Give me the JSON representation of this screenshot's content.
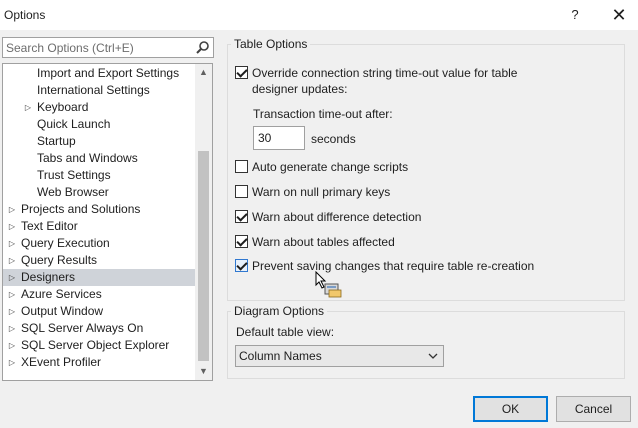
{
  "window": {
    "title": "Options",
    "help_label": "?",
    "close_label": "✕"
  },
  "search": {
    "placeholder": "Search Options (Ctrl+E)"
  },
  "tree": {
    "items": [
      {
        "label": "Import and Export Settings",
        "level": 1,
        "expandable": false,
        "selected": false
      },
      {
        "label": "International Settings",
        "level": 1,
        "expandable": false,
        "selected": false
      },
      {
        "label": "Keyboard",
        "level": 1,
        "expandable": true,
        "selected": false
      },
      {
        "label": "Quick Launch",
        "level": 1,
        "expandable": false,
        "selected": false
      },
      {
        "label": "Startup",
        "level": 1,
        "expandable": false,
        "selected": false
      },
      {
        "label": "Tabs and Windows",
        "level": 1,
        "expandable": false,
        "selected": false
      },
      {
        "label": "Trust Settings",
        "level": 1,
        "expandable": false,
        "selected": false
      },
      {
        "label": "Web Browser",
        "level": 1,
        "expandable": false,
        "selected": false
      },
      {
        "label": "Projects and Solutions",
        "level": 0,
        "expandable": true,
        "selected": false
      },
      {
        "label": "Text Editor",
        "level": 0,
        "expandable": true,
        "selected": false
      },
      {
        "label": "Query Execution",
        "level": 0,
        "expandable": true,
        "selected": false
      },
      {
        "label": "Query Results",
        "level": 0,
        "expandable": true,
        "selected": false
      },
      {
        "label": "Designers",
        "level": 0,
        "expandable": true,
        "selected": true
      },
      {
        "label": "Azure Services",
        "level": 0,
        "expandable": true,
        "selected": false
      },
      {
        "label": "Output Window",
        "level": 0,
        "expandable": true,
        "selected": false
      },
      {
        "label": "SQL Server Always On",
        "level": 0,
        "expandable": true,
        "selected": false
      },
      {
        "label": "SQL Server Object Explorer",
        "level": 0,
        "expandable": true,
        "selected": false
      },
      {
        "label": "XEvent Profiler",
        "level": 0,
        "expandable": true,
        "selected": false
      }
    ]
  },
  "table_options": {
    "title": "Table Options",
    "override_label_line1": "Override connection string time-out value for table",
    "override_label_line2": "designer updates:",
    "override_checked": true,
    "timeout_label": "Transaction time-out after:",
    "timeout_value": "30",
    "timeout_unit": "seconds",
    "options": [
      {
        "label": "Auto generate change scripts",
        "checked": false
      },
      {
        "label": "Warn on null primary keys",
        "checked": false
      },
      {
        "label": "Warn about difference detection",
        "checked": true
      },
      {
        "label": "Warn about tables affected",
        "checked": true
      },
      {
        "label": "Prevent saving changes that require table re-creation",
        "checked": true
      }
    ]
  },
  "diagram_options": {
    "title": "Diagram Options",
    "default_view_label": "Default table view:",
    "default_view_value": "Column Names"
  },
  "buttons": {
    "ok": "OK",
    "cancel": "Cancel"
  }
}
